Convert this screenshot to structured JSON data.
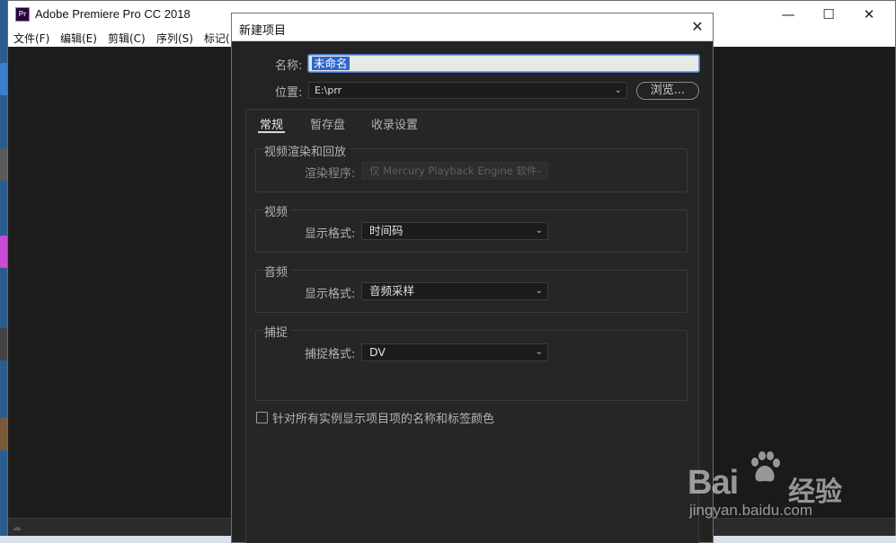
{
  "app": {
    "logo": "Pr",
    "title": "Adobe Premiere Pro CC 2018",
    "minimize": "—",
    "maximize": "☐",
    "close": "✕"
  },
  "menu": [
    "文件(F)",
    "编辑(E)",
    "剪辑(C)",
    "序列(S)",
    "标记("
  ],
  "dialog": {
    "title": "新建项目",
    "close": "✕",
    "name_label": "名称:",
    "name_value": "未命名",
    "location_label": "位置:",
    "location_value": "E:\\prr",
    "browse_label": "浏览...",
    "tabs": [
      "常规",
      "暂存盘",
      "收录设置"
    ],
    "groups": {
      "render": {
        "title": "视频渲染和回放",
        "field_label": "渲染程序:",
        "value": "仅 Mercury Playback Engine 软件"
      },
      "video": {
        "title": "视频",
        "field_label": "显示格式:",
        "value": "时间码"
      },
      "audio": {
        "title": "音频",
        "field_label": "显示格式:",
        "value": "音频采样"
      },
      "capture": {
        "title": "捕捉",
        "field_label": "捕捉格式:",
        "value": "DV"
      }
    },
    "checkbox_label": "针对所有实例显示项目项的名称和标签颜色"
  },
  "watermark": {
    "brand": "Bai",
    "brand2": "经验",
    "url": "jingyan.baidu.com"
  },
  "colors": {
    "dialog_bg": "#232323",
    "panel_bg": "#262626",
    "selection": "#2e67c9"
  }
}
